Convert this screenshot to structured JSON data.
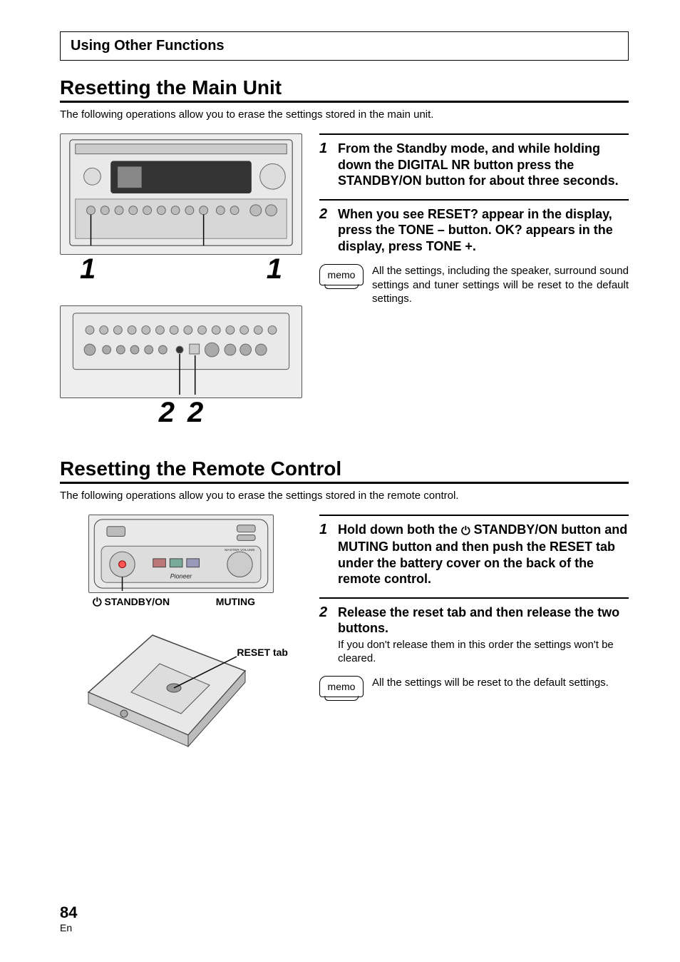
{
  "sectionBar": "Using Other Functions",
  "section1": {
    "title": "Resetting the Main Unit",
    "intro": "The following operations allow you to erase the settings stored in the main unit.",
    "step1": {
      "title": "From the Standby mode, and while holding down the DIGITAL NR button press the STANDBY/ON button for about three seconds."
    },
    "step2": {
      "title": "When you see RESET? appear in the display, press the TONE – button. OK? appears in the display, press TONE +."
    },
    "memo": "All the settings, including the speaker, surround sound settings and tuner settings will be reset to the default settings.",
    "figNums": {
      "topLeft": "1",
      "topRight": "1",
      "bottomLeft": "2",
      "bottomRight": "2"
    }
  },
  "section2": {
    "title": "Resetting the Remote Control",
    "intro": "The following operations allow you to erase the settings stored in the remote control.",
    "labels": {
      "standby": "STANDBY/ON",
      "muting": "MUTING",
      "resetTab": "RESET tab",
      "masterVol": "MASTER VOLUME",
      "brand": "Pioneer"
    },
    "step1": {
      "pre": "Hold down both the ",
      "post": " STANDBY/ON button and MUTING button and then push the RESET tab under the battery cover on the back of the remote control."
    },
    "step2": {
      "title": "Release the reset tab and then release the two buttons.",
      "body": "If you don't release them in this order the settings won't be cleared."
    },
    "memo": "All the settings will be reset to the default settings."
  },
  "memoLabel": "memo",
  "pageNumber": "84",
  "pageLang": "En"
}
